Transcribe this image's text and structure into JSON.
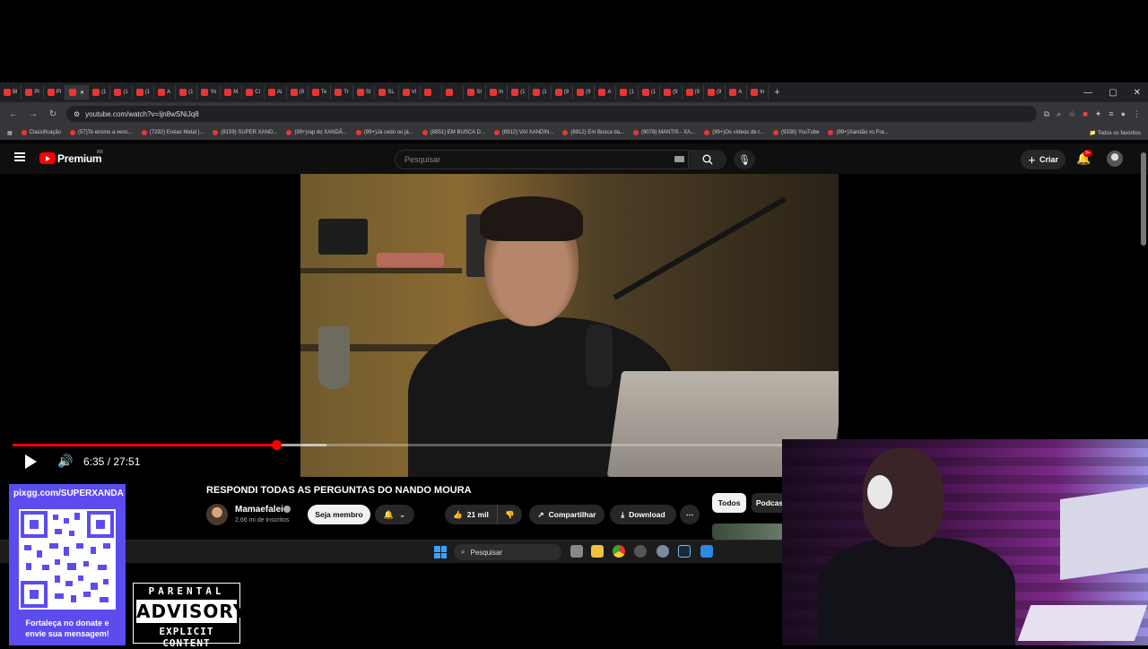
{
  "browser": {
    "tabs": [
      {
        "label": "Bl",
        "active": false
      },
      {
        "label": "Pl",
        "active": false
      },
      {
        "label": "Pl",
        "active": false
      },
      {
        "label": "",
        "active": true
      },
      {
        "label": "(1",
        "active": false
      },
      {
        "label": "(1",
        "active": false
      },
      {
        "label": "(1",
        "active": false
      },
      {
        "label": "A",
        "active": false
      },
      {
        "label": "(1",
        "active": false
      },
      {
        "label": "Yo",
        "active": false
      },
      {
        "label": "M",
        "active": false
      },
      {
        "label": "Cl",
        "active": false
      },
      {
        "label": "AI",
        "active": false
      },
      {
        "label": "(9",
        "active": false
      },
      {
        "label": "Te",
        "active": false
      },
      {
        "label": "Tr",
        "active": false
      },
      {
        "label": "St",
        "active": false
      },
      {
        "label": "SL",
        "active": false
      },
      {
        "label": "VI",
        "active": false
      },
      {
        "label": "",
        "active": false
      },
      {
        "label": "",
        "active": false
      },
      {
        "label": "St",
        "active": false
      },
      {
        "label": "In",
        "active": false
      },
      {
        "label": "(1",
        "active": false
      },
      {
        "label": "(1",
        "active": false
      },
      {
        "label": "(9",
        "active": false
      },
      {
        "label": "(9",
        "active": false
      },
      {
        "label": "A",
        "active": false
      },
      {
        "label": "(1",
        "active": false
      },
      {
        "label": "(1",
        "active": false
      },
      {
        "label": "(9",
        "active": false
      },
      {
        "label": "(9",
        "active": false
      },
      {
        "label": "(9",
        "active": false
      },
      {
        "label": "A",
        "active": false
      },
      {
        "label": "In",
        "active": false
      }
    ],
    "url": "youtube.com/watch?v=Ijn8wSNiJq8",
    "bookmarks": [
      "Classificação",
      "(57)Te ensino a venc...",
      "(7292) Enéas Metal |...",
      "(8159) SUPER XAND...",
      "(99+)rap do XANDÃ...",
      "(99+)Já cedo ou já...",
      "(8851) EM BUSCA D...",
      "(8912) VAI XANDIN...",
      "(8912) Em Busca da...",
      "(9078) MANTIS - XA...",
      "(99+)Os vídeos de r...",
      "(9338) YouTube",
      "(99+)Xandão vs Fra..."
    ],
    "bookmarks_folder": "Todos os favoritos"
  },
  "youtube": {
    "logo_text": "Premium",
    "logo_region": "BR",
    "search_placeholder": "Pesquisar",
    "create_label": "Criar",
    "notif_badge": "9+"
  },
  "player": {
    "time_display": "6:35 / 27:51",
    "progress_fraction": 0.3429,
    "buffered_fraction": 0.407
  },
  "video": {
    "title": "RESPONDI TODAS AS PERGUNTAS DO NANDO MOURA",
    "channel": "Mamaefalei",
    "subscribers": "2,66 mi de inscritos",
    "member_label": "Seja membro",
    "likes": "21 mil",
    "share_label": "Compartilhar",
    "download_label": "Download"
  },
  "chips": {
    "all": "Todos",
    "podcasts": "Podcas"
  },
  "taskbar": {
    "search_label": "Pesquisar"
  },
  "overlay": {
    "qr_url": "pixgg.com/SUPERXANDA",
    "qr_caption_1": "Fortaleça no donate e",
    "qr_caption_2": "envie sua mensagem!",
    "pa_top": "PARENTAL",
    "pa_mid": "ADVISORY",
    "pa_bot": "EXPLICIT CONTENT"
  },
  "colors": {
    "accent": "#ff0000",
    "qr_panel": "#5b4cf0",
    "background": "#0f0f0f"
  }
}
